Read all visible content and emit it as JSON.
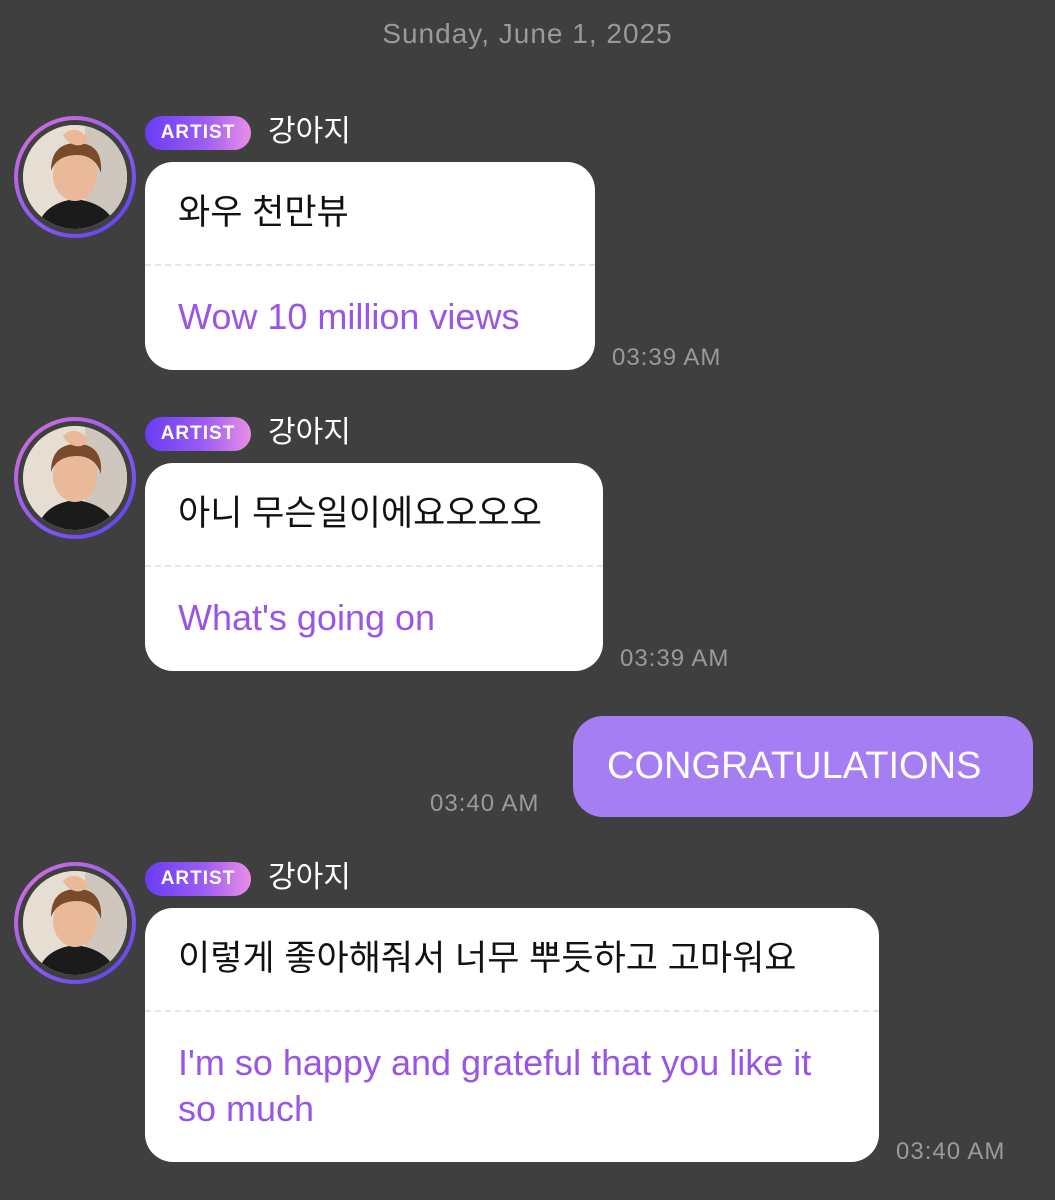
{
  "chat": {
    "date": "Sunday, June 1, 2025",
    "messages": [
      {
        "badge": "ARTIST",
        "sender": "강아지",
        "original": "와우 천만뷰",
        "translation": "Wow 10 million views",
        "time": "03:39 AM"
      },
      {
        "badge": "ARTIST",
        "sender": "강아지",
        "original": "아니 무슨일이에요오오오",
        "translation": "What's going on",
        "time": "03:39 AM"
      },
      {
        "text": "CONGRATULATIONS",
        "time": "03:40 AM"
      },
      {
        "badge": "ARTIST",
        "sender": "강아지",
        "original": "이렇게 좋아해줘서 너무 뿌듯하고 고마워요",
        "translation": "I'm so happy and grateful that you like it so much",
        "time": "03:40 AM"
      }
    ]
  },
  "colors": {
    "background": "#3f3f3f",
    "bubble": "#ffffff",
    "translation_text": "#9a55e6",
    "my_bubble": "#a47ef2",
    "timestamp": "#9a9a9a"
  },
  "icons": {
    "avatar": "artist-profile-photo",
    "badge": "artist-badge"
  }
}
